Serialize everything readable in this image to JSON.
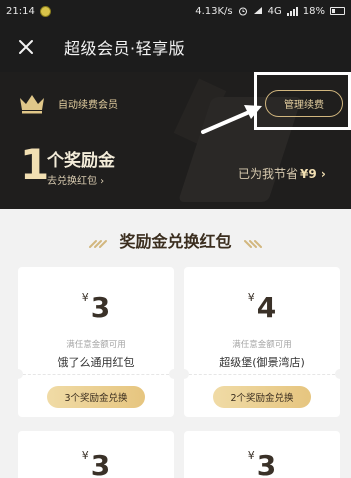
{
  "status_bar": {
    "time": "21:14",
    "network_speed": "4.13K/s",
    "network_type": "4G",
    "battery": "18%"
  },
  "header": {
    "title": "超级会员·轻享版"
  },
  "membership": {
    "auto_renew_label": "自动续费会员",
    "manage_button": "管理续费",
    "bonus_count": "1",
    "bonus_label": "个奖励金",
    "exchange_link": "去兑换红包 ›",
    "saved_prefix": "已为我节省",
    "saved_amount": "¥9 ›"
  },
  "section": {
    "title": "奖励金兑换红包"
  },
  "cards": [
    {
      "currency": "¥",
      "value": "3",
      "condition": "满任意金额可用",
      "name": "饿了么通用红包",
      "button": "3个奖励金兑换"
    },
    {
      "currency": "¥",
      "value": "4",
      "condition": "满任意金额可用",
      "name": "超级堡(御景湾店)",
      "button": "2个奖励金兑换"
    },
    {
      "currency": "¥",
      "value": "3"
    },
    {
      "currency": "¥",
      "value": "3"
    }
  ],
  "colors": {
    "dark_bg": "#1f1e1d",
    "gold": "#e4cfa0",
    "button_gold": "#e6c57f",
    "page_bg": "#f2f2f2"
  }
}
